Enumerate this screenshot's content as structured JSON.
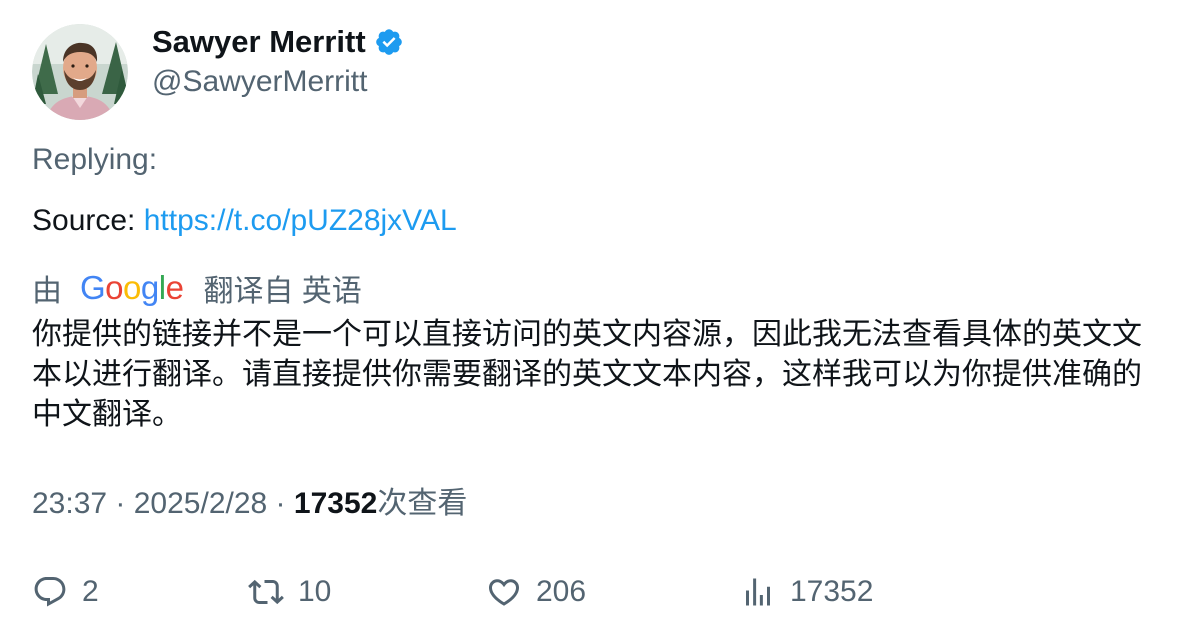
{
  "author": {
    "display_name": "Sawyer Merritt",
    "handle": "@SawyerMerritt",
    "verified": true
  },
  "tweet": {
    "replying_label": "Replying:",
    "source_label": "Source: ",
    "source_link": "https://t.co/pUZ28jxVAL"
  },
  "translation": {
    "prefix": "由",
    "provider": "Google",
    "suffix": "翻译自 英语",
    "text": "你提供的链接并不是一个可以直接访问的英文内容源，因此我无法查看具体的英文文本以进行翻译。请直接提供你需要翻译的英文文本内容，这样我可以为你提供准确的中文翻译。"
  },
  "meta": {
    "time": "23:37",
    "separator1": " · ",
    "date": "2025/2/28",
    "separator2": " · ",
    "views_count": "17352",
    "views_label": "次查看"
  },
  "actions": {
    "reply_count": "2",
    "retweet_count": "10",
    "like_count": "206",
    "views_count": "17352"
  },
  "colors": {
    "link": "#1d9bf0",
    "secondary_text": "#536471",
    "primary_text": "#0f1419",
    "verified": "#1d9bf0"
  },
  "icons": {
    "reply": "reply-icon",
    "retweet": "retweet-icon",
    "like": "heart-icon",
    "views": "views-icon",
    "verified": "verified-badge-icon"
  }
}
